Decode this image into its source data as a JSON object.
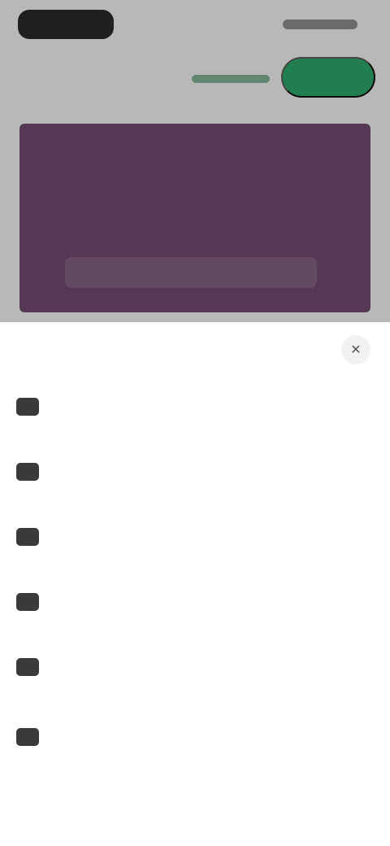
{
  "header": {
    "logo_icon": "brand-logo",
    "header_right_text": "",
    "nav_link_label": "",
    "signup_label": ""
  },
  "hero": {
    "caption": ""
  },
  "sheet": {
    "close_icon": "close-icon",
    "items": [
      {
        "icon": "home-icon",
        "label": ""
      },
      {
        "icon": "grid-icon",
        "label": ""
      },
      {
        "icon": "info-icon",
        "label": ""
      },
      {
        "icon": "chat-icon",
        "label": ""
      },
      {
        "icon": "star-icon",
        "label": ""
      },
      {
        "icon": "user-icon",
        "label": ""
      }
    ]
  },
  "colors": {
    "accent_green": "#1fa45f",
    "hero_purple": "#6a3e67",
    "logo_dark": "#1b1d1e"
  }
}
